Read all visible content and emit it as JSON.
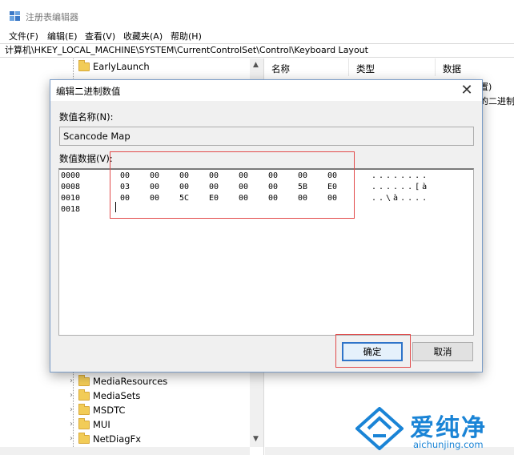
{
  "window": {
    "title": "注册表编辑器"
  },
  "menu": [
    "文件(F)",
    "编辑(E)",
    "查看(V)",
    "收藏夹(A)",
    "帮助(H)"
  ],
  "address": "计算机\\HKEY_LOCAL_MACHINE\\SYSTEM\\CurrentControlSet\\Control\\Keyboard Layout",
  "tree": {
    "top_item": "EarlyLaunch",
    "items": [
      "MediaResources",
      "MediaSets",
      "MSDTC",
      "MUI",
      "NetDiagFx"
    ]
  },
  "values": {
    "headers": {
      "name": "名称",
      "type": "类型",
      "data": "数据"
    },
    "peek_1": "置)",
    "peek_2": "的二进制"
  },
  "dialog": {
    "title": "编辑二进制数值",
    "name_label": "数值名称(N):",
    "name_value": "Scancode Map",
    "data_label": "数值数据(V):",
    "ok": "确定",
    "cancel": "取消",
    "hex_rows": [
      {
        "offset": "0000",
        "bytes": [
          "00",
          "00",
          "00",
          "00",
          "00",
          "00",
          "00",
          "00"
        ],
        "ascii": "........"
      },
      {
        "offset": "0008",
        "bytes": [
          "03",
          "00",
          "00",
          "00",
          "00",
          "00",
          "5B",
          "E0"
        ],
        "ascii": "......[à"
      },
      {
        "offset": "0010",
        "bytes": [
          "00",
          "00",
          "5C",
          "E0",
          "00",
          "00",
          "00",
          "00"
        ],
        "ascii": "..\\à...."
      },
      {
        "offset": "0018",
        "bytes": [],
        "ascii": ""
      }
    ]
  },
  "watermark": {
    "name": "爱纯净",
    "domain": "aichunjing.com"
  },
  "colors": {
    "highlight": "#e24a4a",
    "accent": "#2f74c9",
    "watermark": "#1a84d6"
  }
}
